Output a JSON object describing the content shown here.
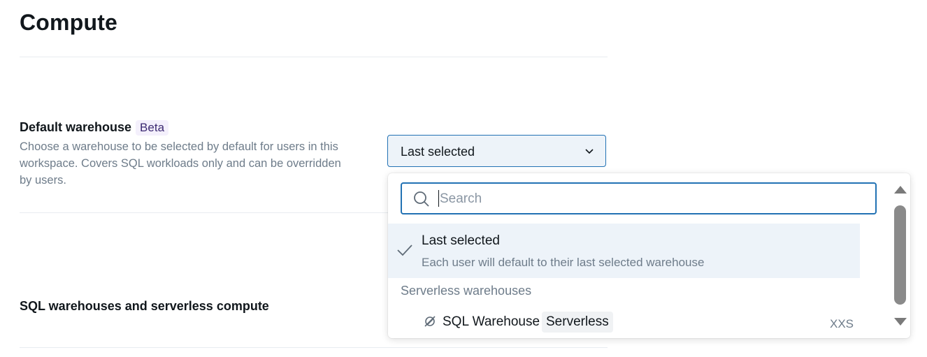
{
  "page": {
    "title": "Compute"
  },
  "default_warehouse": {
    "label": "Default warehouse",
    "badge": "Beta",
    "description": "Choose a warehouse to be selected by default for users in this workspace. Covers SQL workloads only and can be overridden by users.",
    "selected_value": "Last selected"
  },
  "sql_warehouses_section": {
    "label": "SQL warehouses and serverless compute"
  },
  "dropdown": {
    "search_placeholder": "Search",
    "selected_option": {
      "title": "Last selected",
      "description": "Each user will default to their last selected warehouse"
    },
    "group_header": "Serverless warehouses",
    "warehouse": {
      "name": "SQL Warehouse",
      "badge": "Serverless",
      "size": "XXS"
    }
  },
  "colors": {
    "accent": "#2272b4",
    "selected_bg": "#edf3f9",
    "muted_text": "#6e7c8a"
  },
  "icons": [
    "search-icon",
    "check-icon",
    "chevron-down-icon",
    "serverless-icon",
    "scroll-up-arrow-icon",
    "scroll-down-arrow-icon"
  ]
}
